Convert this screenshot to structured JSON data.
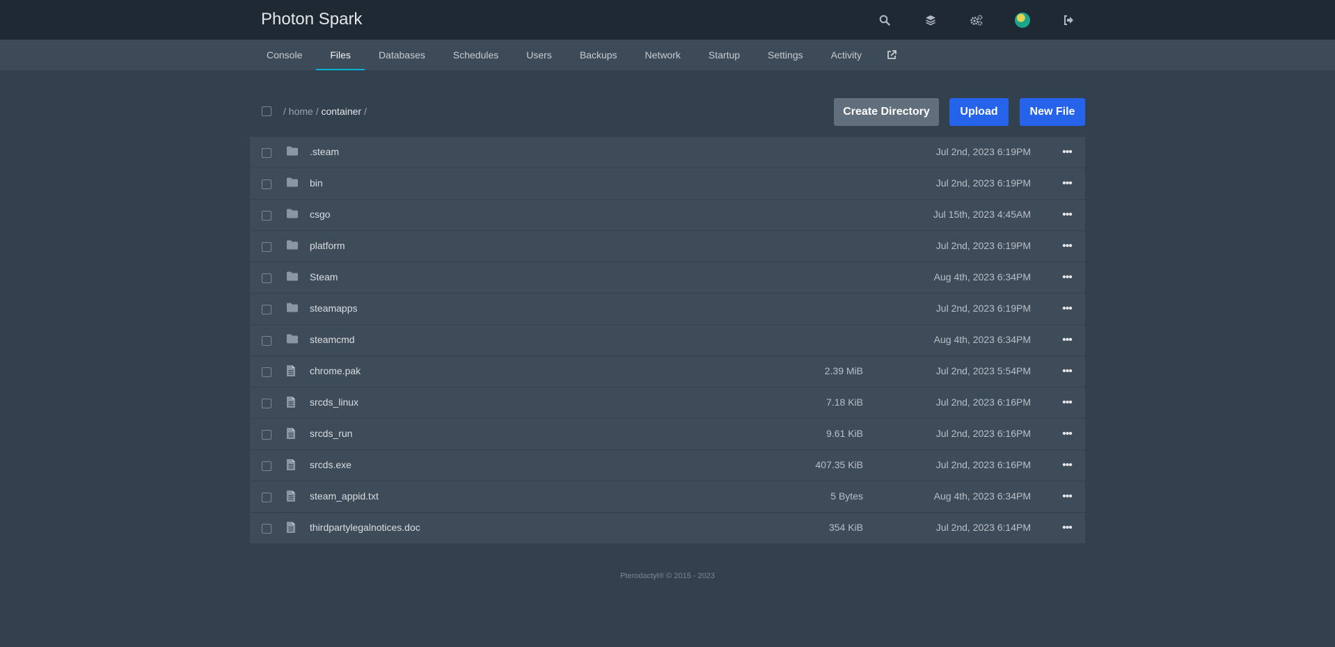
{
  "app": {
    "title": "Photon Spark"
  },
  "topbar": {
    "icons": [
      "search-icon",
      "layers-icon",
      "cogs-icon",
      "avatar",
      "sign-out-icon"
    ]
  },
  "nav": {
    "items": [
      {
        "label": "Console",
        "active": false
      },
      {
        "label": "Files",
        "active": true
      },
      {
        "label": "Databases",
        "active": false
      },
      {
        "label": "Schedules",
        "active": false
      },
      {
        "label": "Users",
        "active": false
      },
      {
        "label": "Backups",
        "active": false
      },
      {
        "label": "Network",
        "active": false
      },
      {
        "label": "Startup",
        "active": false
      },
      {
        "label": "Settings",
        "active": false
      },
      {
        "label": "Activity",
        "active": false
      }
    ],
    "external_icon": "external-link-icon"
  },
  "breadcrumb": {
    "sep": "/",
    "parts": [
      "home",
      "container"
    ]
  },
  "actions": {
    "create_directory": "Create Directory",
    "upload": "Upload",
    "new_file": "New File"
  },
  "files": [
    {
      "name": ".steam",
      "type": "folder",
      "size": "",
      "date": "Jul 2nd, 2023 6:19PM"
    },
    {
      "name": "bin",
      "type": "folder",
      "size": "",
      "date": "Jul 2nd, 2023 6:19PM"
    },
    {
      "name": "csgo",
      "type": "folder",
      "size": "",
      "date": "Jul 15th, 2023 4:45AM"
    },
    {
      "name": "platform",
      "type": "folder",
      "size": "",
      "date": "Jul 2nd, 2023 6:19PM"
    },
    {
      "name": "Steam",
      "type": "folder",
      "size": "",
      "date": "Aug 4th, 2023 6:34PM"
    },
    {
      "name": "steamapps",
      "type": "folder",
      "size": "",
      "date": "Jul 2nd, 2023 6:19PM"
    },
    {
      "name": "steamcmd",
      "type": "folder",
      "size": "",
      "date": "Aug 4th, 2023 6:34PM"
    },
    {
      "name": "chrome.pak",
      "type": "file",
      "size": "2.39 MiB",
      "date": "Jul 2nd, 2023 5:54PM"
    },
    {
      "name": "srcds_linux",
      "type": "file",
      "size": "7.18 KiB",
      "date": "Jul 2nd, 2023 6:16PM"
    },
    {
      "name": "srcds_run",
      "type": "file",
      "size": "9.61 KiB",
      "date": "Jul 2nd, 2023 6:16PM"
    },
    {
      "name": "srcds.exe",
      "type": "file",
      "size": "407.35 KiB",
      "date": "Jul 2nd, 2023 6:16PM"
    },
    {
      "name": "steam_appid.txt",
      "type": "file",
      "size": "5 Bytes",
      "date": "Aug 4th, 2023 6:34PM"
    },
    {
      "name": "thirdpartylegalnotices.doc",
      "type": "file",
      "size": "354 KiB",
      "date": "Jul 2nd, 2023 6:14PM"
    }
  ],
  "row_menu_label": "•••",
  "footer": {
    "text": "Pterodactyl® © 2015 - 2023"
  },
  "colors": {
    "accent": "#06b6d4",
    "primary_button": "#2563eb",
    "secondary_button": "#616e7c"
  }
}
